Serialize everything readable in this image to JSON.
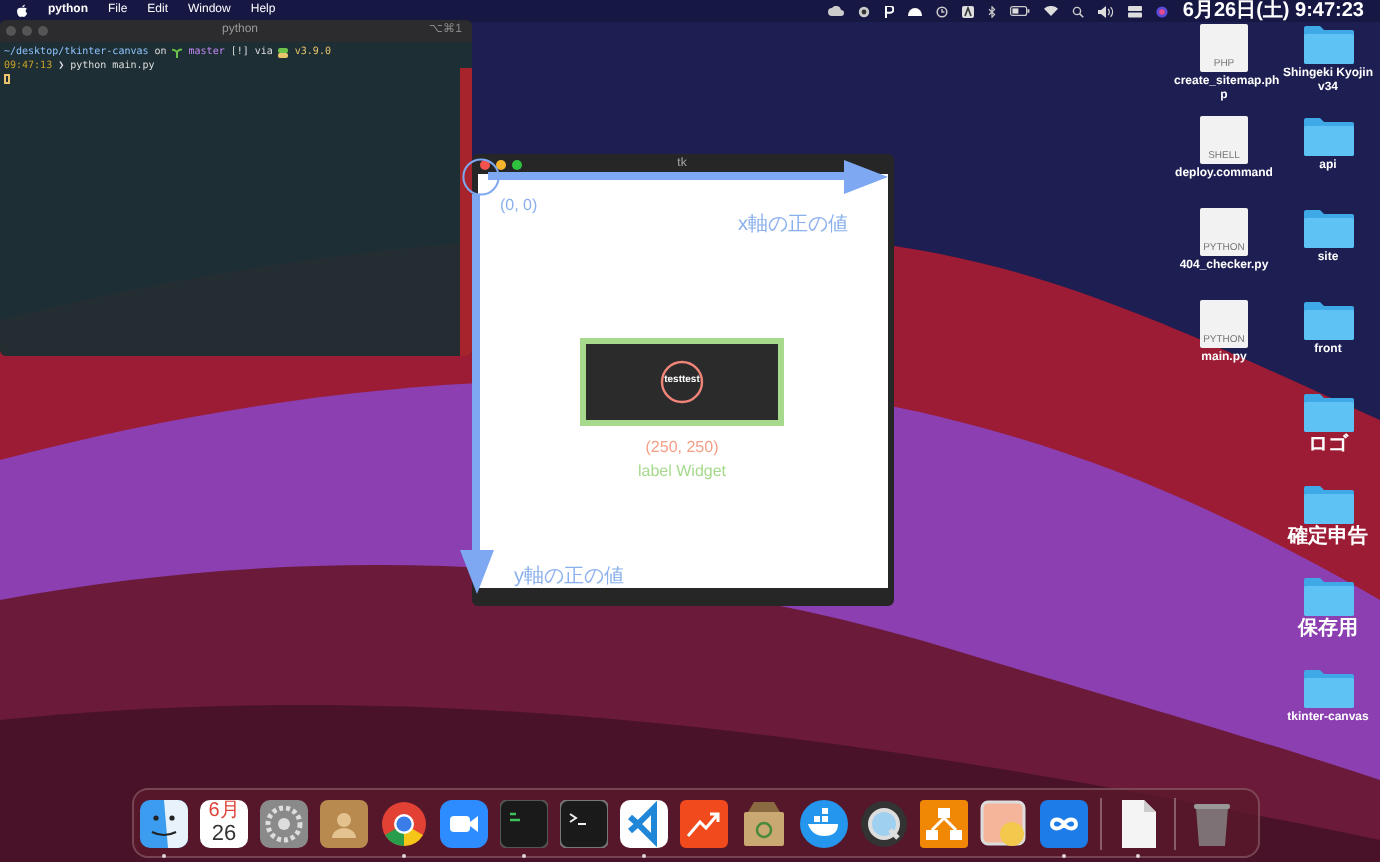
{
  "menubar": {
    "app_name": "python",
    "menus": [
      "File",
      "Edit",
      "Window",
      "Help"
    ],
    "clock": "6月26日(土) 9:47:23"
  },
  "terminal": {
    "title": "python",
    "shortcut": "⌥⌘1",
    "lines": [
      [
        {
          "kind": "path",
          "text": "~/desktop/tkinter-canvas"
        },
        {
          "kind": "plain",
          "text": "on"
        },
        {
          "kind": "branch",
          "text": "master"
        },
        {
          "kind": "status",
          "text": "[!]"
        },
        {
          "kind": "plain",
          "text": "via"
        },
        {
          "kind": "version",
          "text": "v3.9.0"
        }
      ],
      [
        {
          "kind": "time",
          "text": "09:47:13"
        },
        {
          "kind": "prompt",
          "text": "❯"
        },
        {
          "kind": "plain",
          "text": "python main.py"
        }
      ]
    ]
  },
  "tk_window": {
    "title": "tk",
    "origin_label": "(0, 0)",
    "x_axis_label": "x軸の正の値",
    "y_axis_label": "y軸の正の値",
    "widget": {
      "text": "testtest",
      "position_label": "(250, 250)",
      "caption": "label Widget"
    }
  },
  "desktop": {
    "columns": [
      [
        {
          "kind": "file",
          "label": "create_sitemap.ph p",
          "badge": "PHP"
        },
        {
          "kind": "file",
          "label": "deploy.command",
          "badge": "SHELL"
        },
        {
          "kind": "file",
          "label": "404_checker.py",
          "badge": "PYTHON"
        },
        {
          "kind": "file",
          "label": "main.py",
          "badge": "PYTHON"
        }
      ],
      [
        {
          "kind": "folder",
          "label": "Shingeki Kyojin v34"
        },
        {
          "kind": "folder",
          "label": "api"
        },
        {
          "kind": "folder",
          "label": "site"
        },
        {
          "kind": "folder",
          "label": "front"
        },
        {
          "kind": "folder",
          "label": "ロゴ"
        },
        {
          "kind": "folder",
          "label": "確定申告"
        },
        {
          "kind": "folder",
          "label": "保存用"
        },
        {
          "kind": "folder",
          "label": "tkinter-canvas"
        }
      ]
    ]
  },
  "dock": {
    "items": [
      {
        "kind": "finder",
        "running": true
      },
      {
        "kind": "calendar",
        "running": false,
        "month": "6月",
        "day": "26"
      },
      {
        "kind": "settings",
        "running": false
      },
      {
        "kind": "contacts",
        "running": false
      },
      {
        "kind": "chrome",
        "running": true
      },
      {
        "kind": "zoom",
        "running": false
      },
      {
        "kind": "console",
        "running": true
      },
      {
        "kind": "terminal",
        "running": false
      },
      {
        "kind": "editor",
        "running": true
      },
      {
        "kind": "chart",
        "running": false
      },
      {
        "kind": "archive",
        "running": false
      },
      {
        "kind": "docker",
        "running": false
      },
      {
        "kind": "quicktime",
        "running": false
      },
      {
        "kind": "diagram",
        "running": false
      },
      {
        "kind": "preview",
        "running": false
      },
      {
        "kind": "infinity",
        "running": true
      },
      {
        "kind": "separator"
      },
      {
        "kind": "document",
        "running": true
      },
      {
        "kind": "separator"
      },
      {
        "kind": "trash",
        "running": false
      }
    ]
  }
}
